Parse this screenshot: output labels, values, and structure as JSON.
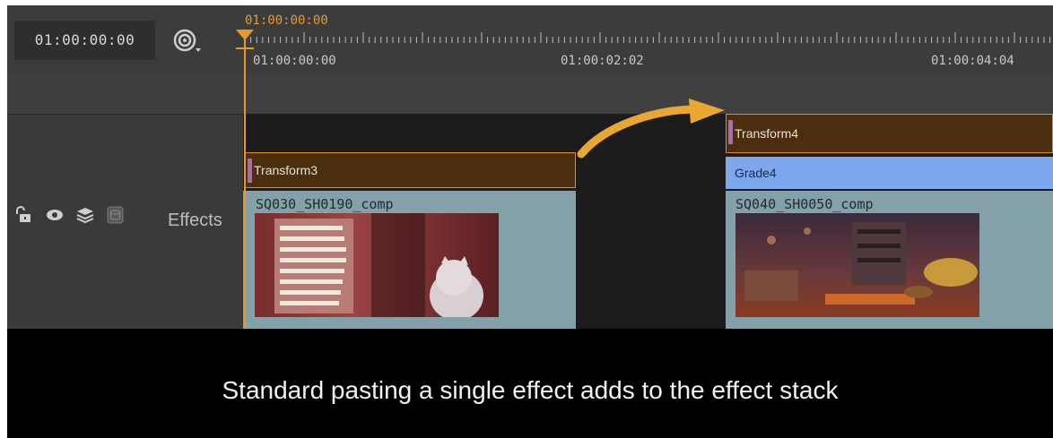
{
  "header": {
    "timecode": "01:00:00:00",
    "snap_icon": "snap-target-icon"
  },
  "ruler": {
    "playhead_timecode": "01:00:00:00",
    "labels": [
      "01:00:00:00",
      "01:00:02:02",
      "01:00:04:04"
    ]
  },
  "track": {
    "name": "Effects",
    "icons": [
      "lock-open-icon",
      "eye-icon",
      "layers-icon",
      "disk-icon"
    ]
  },
  "clips": [
    {
      "effects": [
        "Transform3"
      ],
      "name": "SQ030_SH0190_comp"
    },
    {
      "effects": [
        "Transform4",
        "Grade4"
      ],
      "name": "SQ040_SH0050_comp"
    }
  ],
  "colors": {
    "accent": "#e39a2b",
    "effect_bar": "#4a2e0e",
    "grade_bar": "#7fa7ee",
    "clip_body": "#84a0a8"
  },
  "caption": "Standard pasting a single effect adds to the effect stack"
}
